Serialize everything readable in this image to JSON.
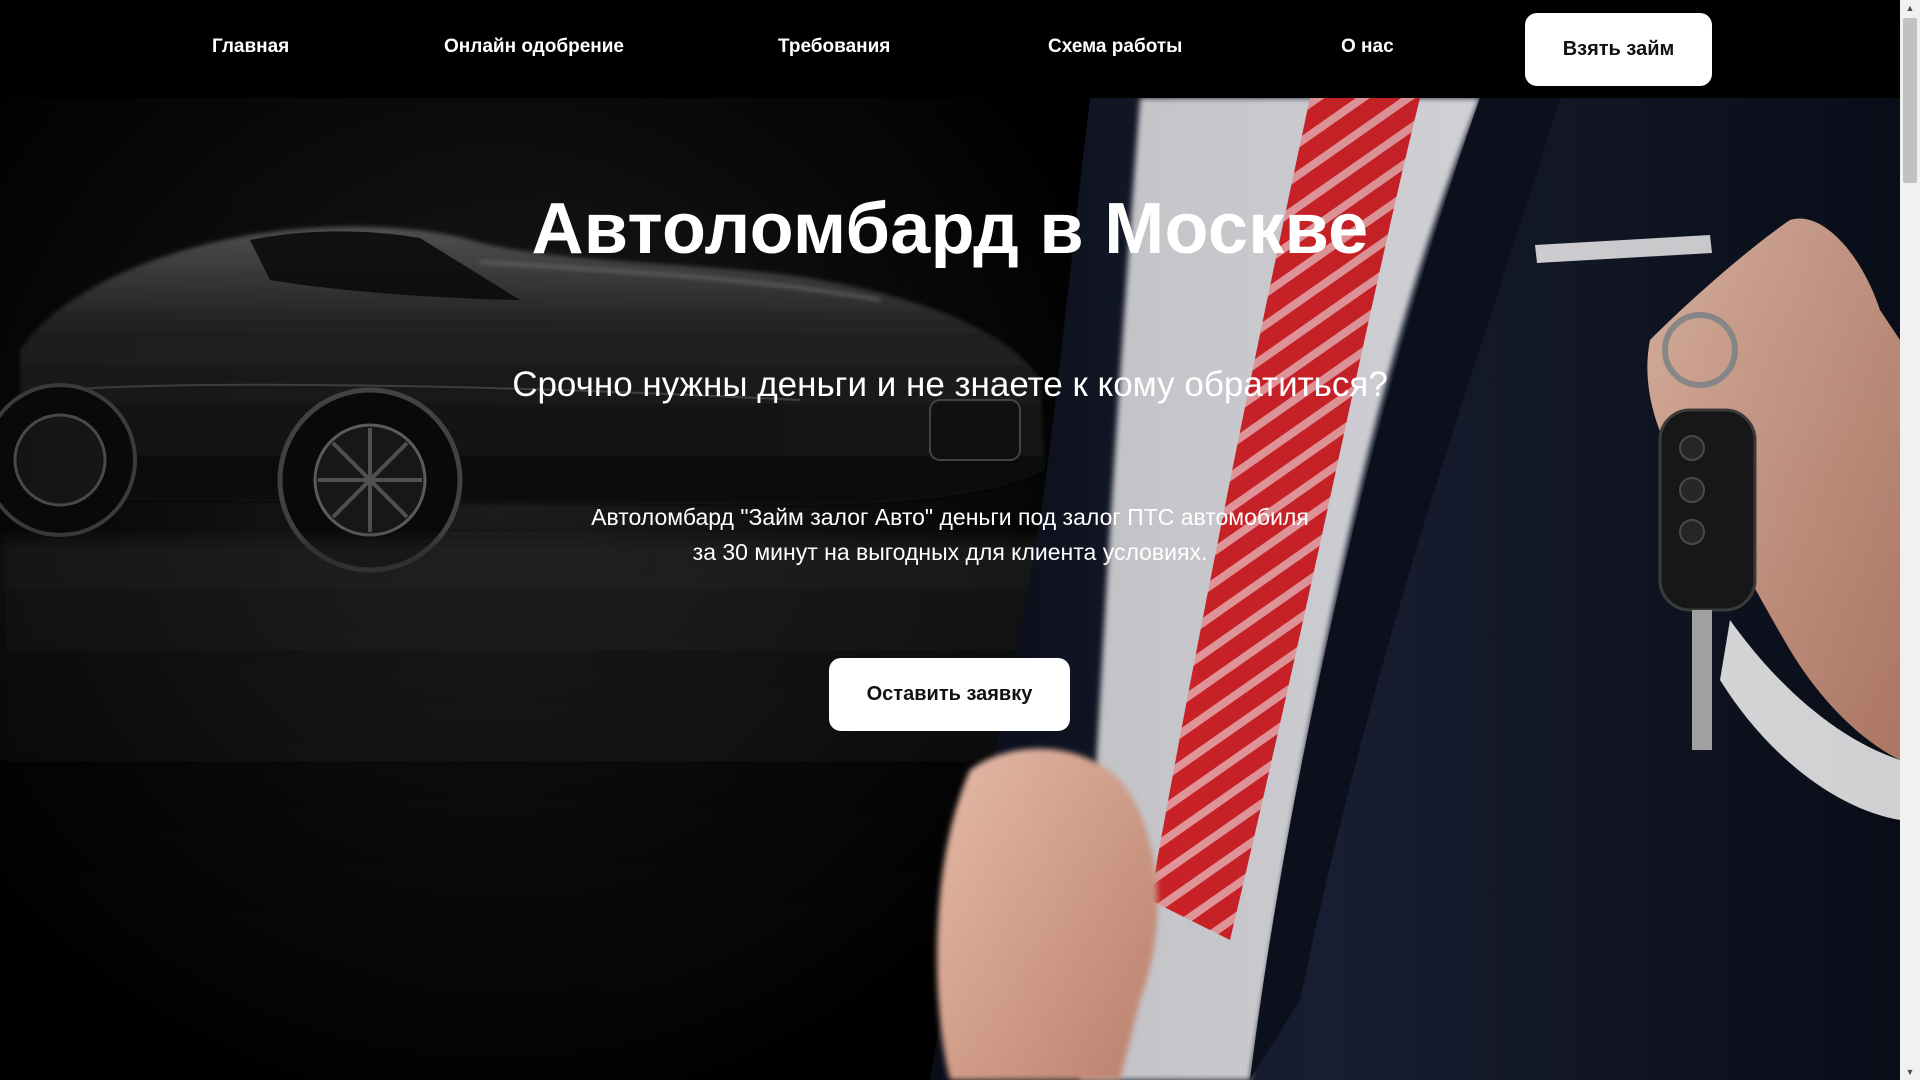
{
  "nav": {
    "items": [
      {
        "label": "Главная"
      },
      {
        "label": "Онлайн одобрение"
      },
      {
        "label": "Требования"
      },
      {
        "label": "Схема работы"
      },
      {
        "label": "О нас"
      }
    ],
    "cta_label": "Взять займ"
  },
  "hero": {
    "title": "Автоломбард в Москве",
    "subtitle": "Срочно нужны деньги и не знаете к кому обратиться?",
    "description_lines": [
      "Автоломбард \"Займ залог Авто\" деньги под залог ПТС автомобиля",
      "за 30 минут на выгодных для клиента условиях."
    ],
    "cta_label": "Оставить заявку"
  },
  "colors": {
    "background": "#000000",
    "button_bg": "#ffffff",
    "button_text": "#111111",
    "tie_red": "#d8242b",
    "suit_navy": "#141a2c"
  },
  "icons": {
    "scroll_up": "triangle-up",
    "scroll_down": "triangle-down"
  }
}
